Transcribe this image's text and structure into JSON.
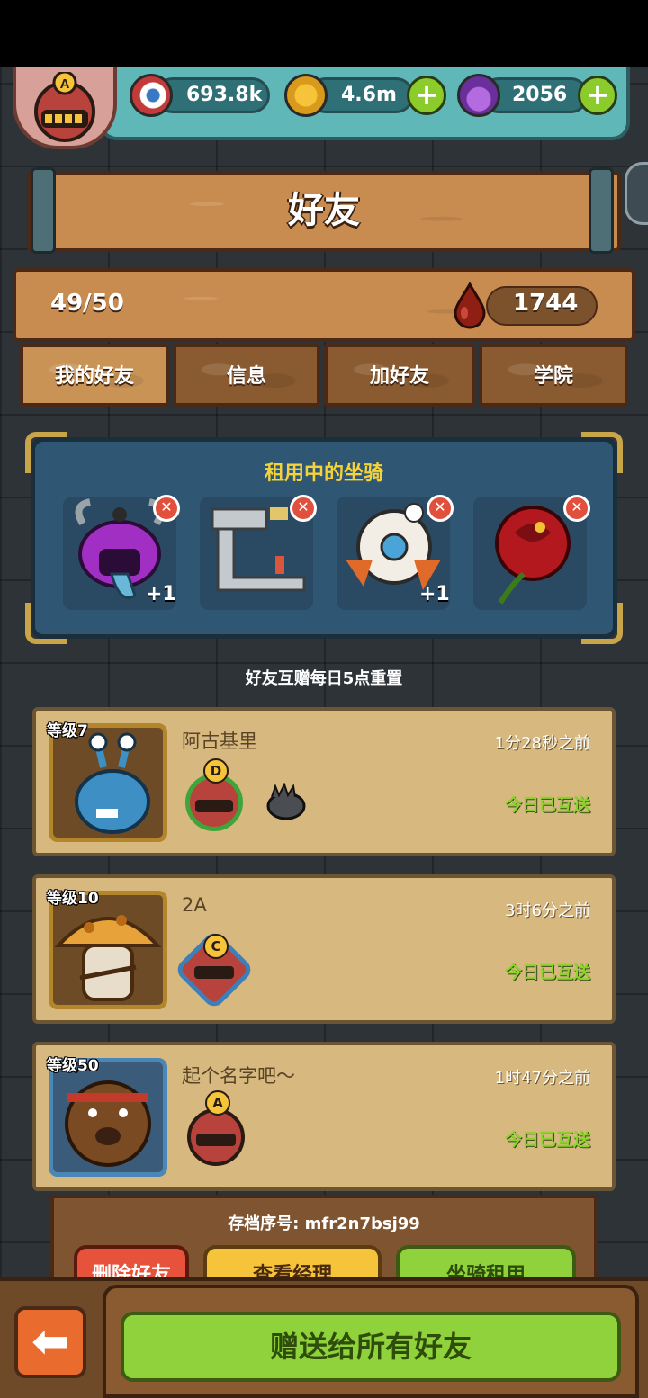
{
  "resources": {
    "eyeballs": "693.8k",
    "coins": "4.6m",
    "potions": "2056"
  },
  "player_rank": "A",
  "title": "好友",
  "friend_count": "49/50",
  "blood": "1744",
  "tabs": [
    "我的好友",
    "信息",
    "加好友",
    "学院"
  ],
  "rent_panel": {
    "title": "租用中的坐骑",
    "slots": [
      {
        "bonus": "+1"
      },
      {
        "bonus": ""
      },
      {
        "bonus": "+1"
      },
      {
        "bonus": ""
      }
    ]
  },
  "reset_note": "好友互赠每日5点重置",
  "friends": [
    {
      "level": "等级7",
      "name": "阿古基里",
      "time": "1分28秒之前",
      "status": "今日已互送",
      "rank": "D"
    },
    {
      "level": "等级10",
      "name": "2A",
      "time": "3时6分之前",
      "status": "今日已互送",
      "rank": "C"
    },
    {
      "level": "等级50",
      "name": "起个名字吧～",
      "time": "1时47分之前",
      "status": "今日已互送",
      "rank": "A"
    }
  ],
  "save_no": "存档序号: mfr2n7bsj99",
  "buttons": {
    "delete": "删除好友",
    "view_manager": "查看经理",
    "rent_mount": "坐骑租用",
    "gift_all": "赠送给所有好友"
  },
  "colors": {
    "accent_green": "#8fd23b",
    "sent_green": "#8cd32c",
    "title_yellow": "#f4d23b",
    "delete_red": "#e0503c"
  }
}
